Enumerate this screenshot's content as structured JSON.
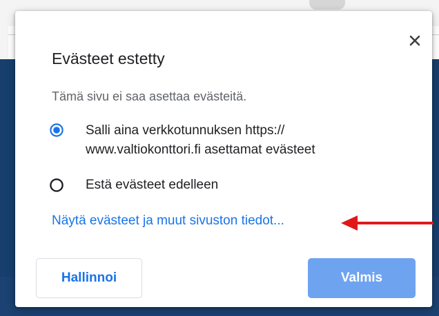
{
  "popup": {
    "title": "Evästeet estetty",
    "description": "Tämä sivu ei saa asettaa evästeitä.",
    "close_icon": "close-icon",
    "options": [
      {
        "label": "Salli aina verkkotunnuksen https:// www.valtiokonttori.fi asettamat evästeet",
        "selected": true
      },
      {
        "label": "Estä evästeet edelleen",
        "selected": false
      }
    ],
    "details_link": "Näytä evästeet ja muut sivuston tiedot...",
    "annotation_icon": "red-arrow-left-icon",
    "buttons": {
      "manage_label": "Hallinnoi",
      "done_label": "Valmis"
    }
  },
  "colors": {
    "accent": "#1a73e8",
    "done_button": "#6ea3f0",
    "arrow": "#e01818",
    "page_background": "#173f6d"
  }
}
